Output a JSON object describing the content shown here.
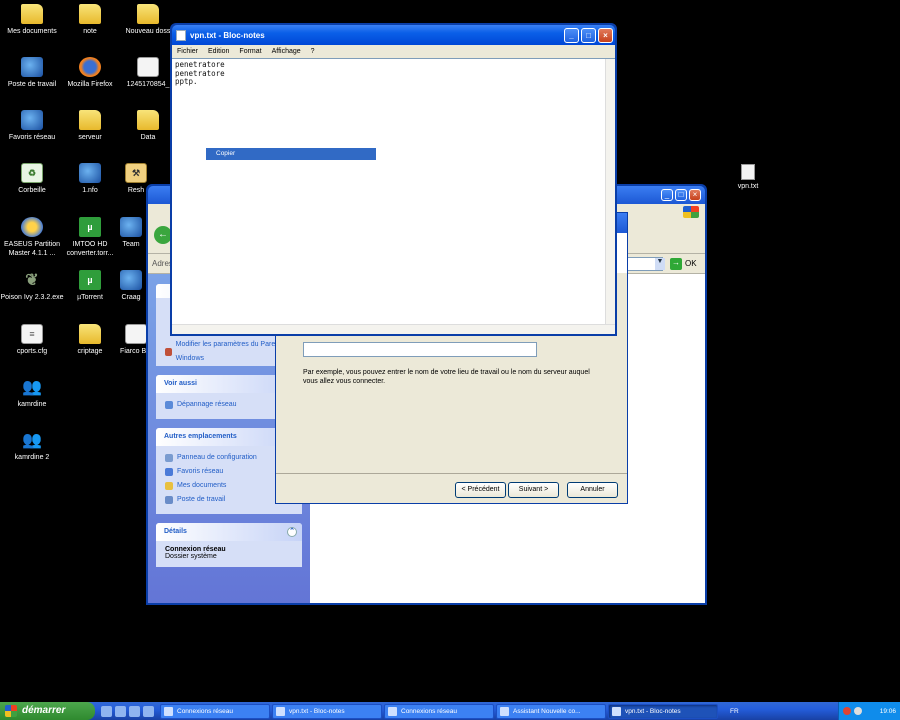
{
  "desktop": {
    "icons": [
      {
        "label": "Mes documents",
        "icon": "folder-docs-icon"
      },
      {
        "label": "note",
        "icon": "folder-icon"
      },
      {
        "label": "Nouveau doss",
        "icon": "folder-icon"
      },
      {
        "label": "Poste de travail",
        "icon": "computer-icon"
      },
      {
        "label": "Mozilla Firefox",
        "icon": "firefox-icon"
      },
      {
        "label": "1245170854_",
        "icon": "file-icon"
      },
      {
        "label": "Favoris réseau",
        "icon": "network-icon"
      },
      {
        "label": "serveur",
        "icon": "folder-icon"
      },
      {
        "label": "Data",
        "icon": "folder-icon"
      },
      {
        "label": "Corbeille",
        "icon": "recycle-bin-icon"
      },
      {
        "label": "1.nfo",
        "icon": "nfo-icon"
      },
      {
        "label": "Resh",
        "icon": "tool-icon"
      },
      {
        "label": "EASEUS Partition Master 4.1.1 ...",
        "icon": "partition-icon"
      },
      {
        "label": "IMTOO HD converter.torr...",
        "icon": "utorrent-icon"
      },
      {
        "label": "Team",
        "icon": "team-icon"
      },
      {
        "label": "Poison Ivy 2.3.2.exe",
        "icon": "leaf-icon"
      },
      {
        "label": "µTorrent",
        "icon": "utorrent-icon"
      },
      {
        "label": "Craag",
        "icon": "app-icon"
      },
      {
        "label": "cports.cfg",
        "icon": "config-file-icon"
      },
      {
        "label": "criptage",
        "icon": "folder-icon"
      },
      {
        "label": "Fiarco BM",
        "icon": "app-icon"
      },
      {
        "label": "kamrdine",
        "icon": "user-icon"
      },
      {
        "label": "kamrdine 2",
        "icon": "user-icon"
      }
    ],
    "vpn_icon_label": "vpn.txt"
  },
  "explorer": {
    "address_label": "Adres",
    "ok_label": "OK",
    "left_partial_link": "Modifier les paramètres du Pare-feu Windows",
    "panels": {
      "voir_aussi": {
        "title": "Voir aussi",
        "links": [
          "Dépannage réseau"
        ]
      },
      "autres": {
        "title": "Autres emplacements",
        "links": [
          "Panneau de configuration",
          "Favoris réseau",
          "Mes documents",
          "Poste de travail"
        ]
      },
      "details": {
        "title": "Détails",
        "name": "Connexion réseau",
        "sub": "Dossier système"
      }
    }
  },
  "wizard": {
    "description": "Par exemple, vous pouvez entrer le nom de votre lieu de travail ou le nom du serveur auquel vous allez vous connecter.",
    "input_value": "",
    "buttons": {
      "back": "< Précédent",
      "next": "Suivant >",
      "cancel": "Annuler"
    }
  },
  "notepad": {
    "title": "vpn.txt - Bloc-notes",
    "menu": [
      "Fichier",
      "Edition",
      "Format",
      "Affichage",
      "?"
    ],
    "lines": [
      "penetratore",
      "penetratore",
      "pptp."
    ],
    "context_item": "Copier",
    "window_buttons": {
      "minimize": "_",
      "maximize": "□",
      "close": "×"
    }
  },
  "taskbar": {
    "start_label": "démarrer",
    "tasks": [
      {
        "label": "Connexions réseau",
        "active": false
      },
      {
        "label": "vpn.txt - Bloc-notes",
        "active": false
      },
      {
        "label": "Connexions réseau",
        "active": false
      },
      {
        "label": "Assistant Nouvelle co...",
        "active": false
      },
      {
        "label": "vpn.txt - Bloc-notes",
        "active": true
      }
    ],
    "language": "FR",
    "clock": "19:06"
  }
}
